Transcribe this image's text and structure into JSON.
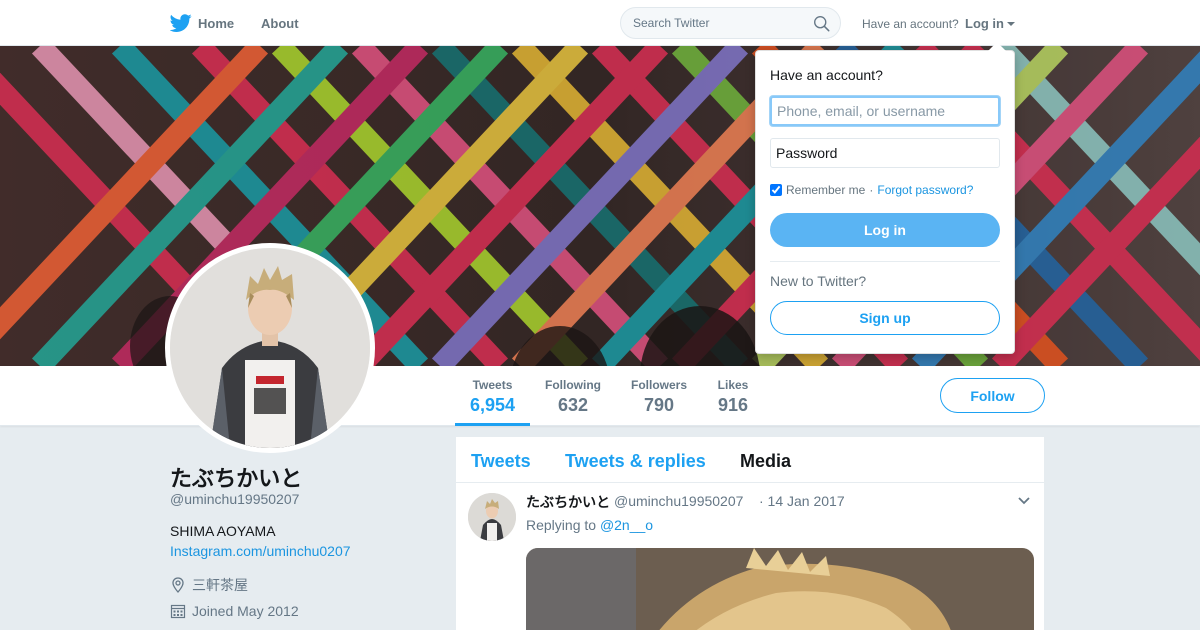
{
  "topbar": {
    "home_label": "Home",
    "about_label": "About",
    "search_placeholder": "Search Twitter",
    "have_account": "Have an account?",
    "login_label": "Log in"
  },
  "profile": {
    "name": "たぶちかいと",
    "handle": "@uminchu19950207",
    "bio": "SHIMA AOYAMA",
    "link": "Instagram.com/uminchu0207",
    "location": "三軒茶屋",
    "joined": "Joined May 2012"
  },
  "stats": [
    {
      "label": "Tweets",
      "value": "6,954"
    },
    {
      "label": "Following",
      "value": "632"
    },
    {
      "label": "Followers",
      "value": "790"
    },
    {
      "label": "Likes",
      "value": "916"
    }
  ],
  "follow_label": "Follow",
  "timeline": {
    "tabs": [
      "Tweets",
      "Tweets & replies",
      "Media"
    ],
    "active_tab": "Media",
    "tweet": {
      "name": "たぶちかいと",
      "handle": "@uminchu19950207",
      "time": "· 14 Jan 2017",
      "replying_prefix": "Replying to",
      "replying_to": "@2n__o"
    }
  },
  "login_dropdown": {
    "title": "Have an account?",
    "username_placeholder": "Phone, email, or username",
    "password_placeholder": "Password",
    "remember_me": "Remember me",
    "separator": "·",
    "forgot_password": "Forgot password?",
    "login_button": "Log in",
    "new_to_twitter": "New to Twitter?",
    "signup_button": "Sign up"
  },
  "colors": {
    "accent": "#1da1f2",
    "link": "#1b95e0",
    "background": "#e6ecf0"
  },
  "icons": [
    "twitter-bird-icon",
    "search-icon",
    "location-icon",
    "calendar-icon",
    "chevron-down-icon"
  ]
}
